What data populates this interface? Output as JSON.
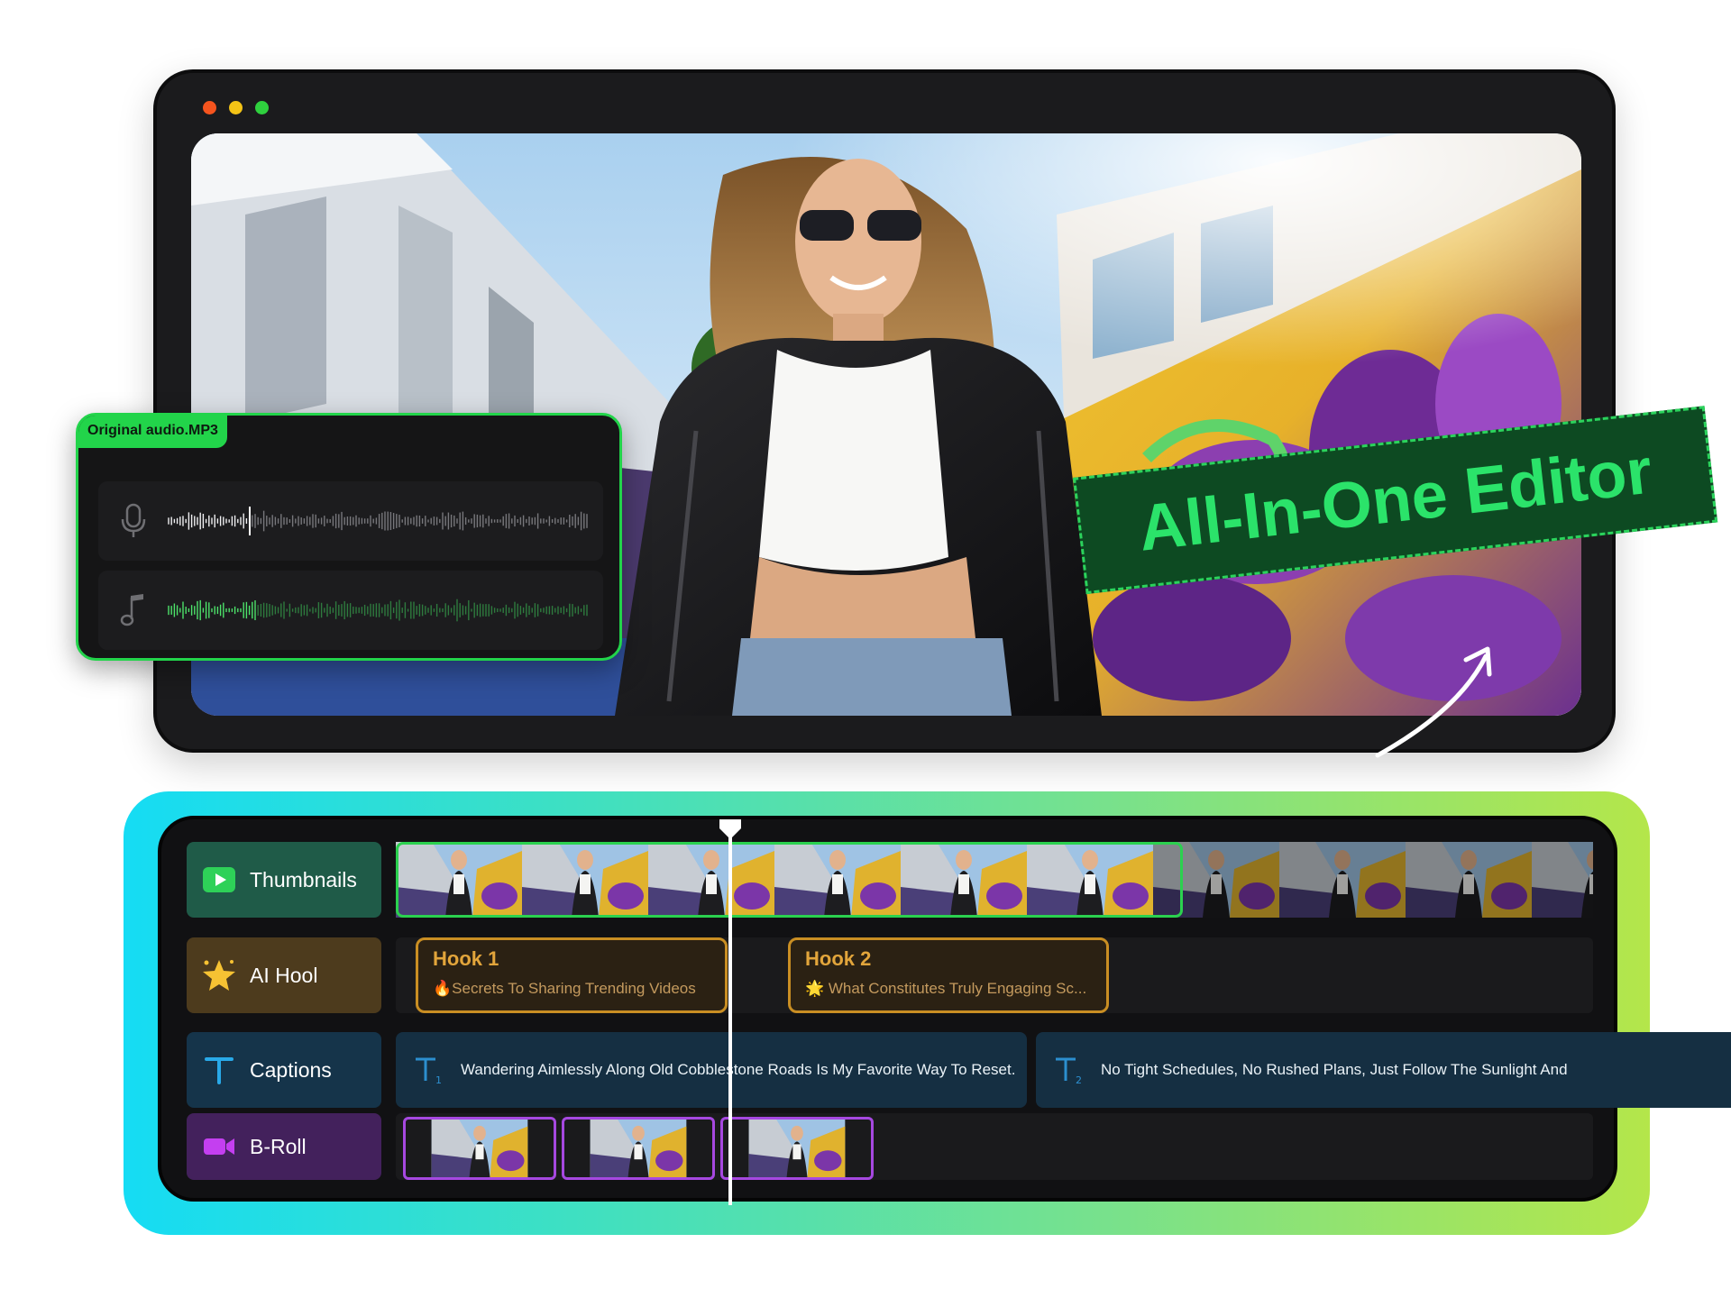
{
  "window": {
    "controls": [
      "close",
      "minimize",
      "maximize"
    ],
    "colors": {
      "close": "#f5541e",
      "minimize": "#f3c316",
      "maximize": "#2fd03e"
    }
  },
  "preview": {
    "image": "woman-in-leather-jacket-graffiti-street"
  },
  "audio_panel": {
    "file_name": "Original audio.MP3",
    "tracks": [
      {
        "icon": "microphone-icon"
      },
      {
        "icon": "music-note-icon"
      }
    ]
  },
  "promo": {
    "text": "All-In-One Editor"
  },
  "timeline": {
    "tracks": [
      {
        "id": "thumbnails",
        "label": "Thumbnails",
        "icon": "play-icon",
        "color": "#1f5b48"
      },
      {
        "id": "ai-hook",
        "label": "AI Hool",
        "icon": "sparkle-star-icon",
        "color": "#4d3b1d"
      },
      {
        "id": "captions",
        "label": "Captions",
        "icon": "text-t-icon",
        "color": "#15344a"
      },
      {
        "id": "b-roll",
        "label": "B-Roll",
        "icon": "video-camera-icon",
        "color": "#43215c"
      }
    ],
    "hooks": [
      {
        "title": "Hook 1",
        "description": "🔥Secrets To Sharing Trending Videos"
      },
      {
        "title": "Hook 2",
        "description": "🌟 What Constitutes Truly Engaging Sc..."
      }
    ],
    "captions": [
      {
        "sub": "1",
        "text": "Wandering Aimlessly Along Old Cobblestone Roads Is My Favorite Way To Reset."
      },
      {
        "sub": "2",
        "text": "No Tight Schedules, No Rushed Plans, Just Follow The Sunlight And"
      }
    ],
    "colors": {
      "accent_green": "#2bd14f",
      "hook_border": "#c98e23",
      "broll_border": "#a648e0"
    }
  }
}
